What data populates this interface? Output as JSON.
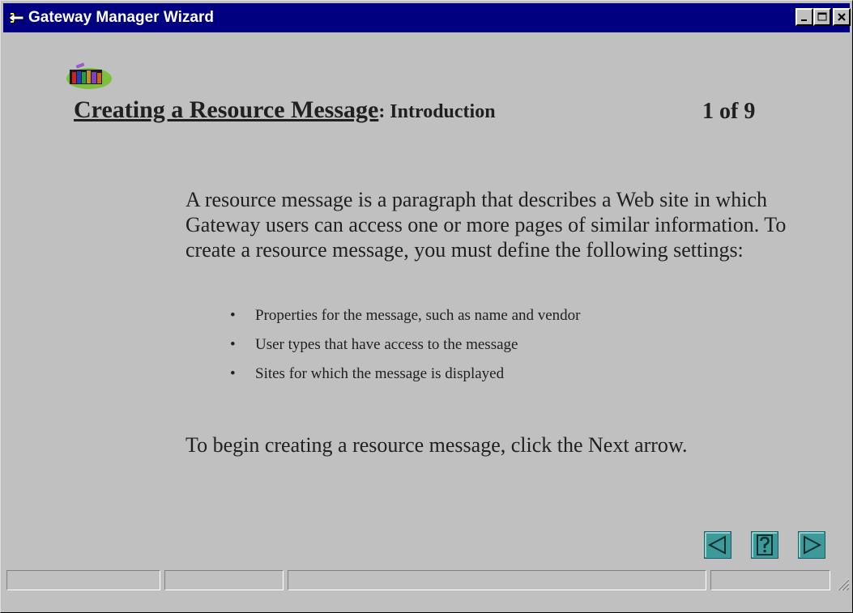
{
  "window": {
    "title": "Gateway Manager Wizard"
  },
  "icons": {
    "title_icon": "wizard-arrow-icon",
    "app_icon": "books-computer-icon",
    "minimize": "minimize-icon",
    "maximize": "maximize-icon",
    "close": "close-icon",
    "prev": "previous-arrow-icon",
    "help": "help-question-icon",
    "next": "next-arrow-icon",
    "grip": "resize-grip-icon"
  },
  "heading": {
    "main": "Creating a Resource Message",
    "sub": ": Introduction"
  },
  "page_counter": "1 of 9",
  "intro": "A resource message is a paragraph that describes a Web site in which Gateway users can access one or more pages of similar information. To create a resource message, you must define the following settings:",
  "bullets": [
    "Properties for the message, such as name and vendor",
    "User types that have access to the message",
    "Sites for which the message is displayed"
  ],
  "bullet_glyph": "•",
  "cta": "To begin creating a resource message, click the Next arrow.",
  "colors": {
    "titlebar": "#000080",
    "window_bg": "#c0c0c0",
    "nav_button": "#3e9a9a"
  }
}
